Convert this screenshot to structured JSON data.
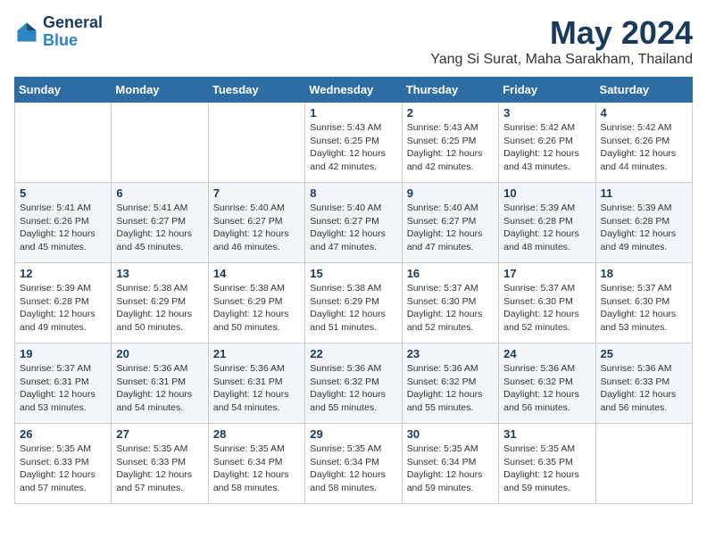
{
  "header": {
    "logo_line1": "General",
    "logo_line2": "Blue",
    "title": "May 2024",
    "subtitle": "Yang Si Surat, Maha Sarakham, Thailand"
  },
  "columns": [
    "Sunday",
    "Monday",
    "Tuesday",
    "Wednesday",
    "Thursday",
    "Friday",
    "Saturday"
  ],
  "weeks": [
    [
      {
        "day": "",
        "info": ""
      },
      {
        "day": "",
        "info": ""
      },
      {
        "day": "",
        "info": ""
      },
      {
        "day": "1",
        "info": "Sunrise: 5:43 AM\nSunset: 6:25 PM\nDaylight: 12 hours\nand 42 minutes."
      },
      {
        "day": "2",
        "info": "Sunrise: 5:43 AM\nSunset: 6:25 PM\nDaylight: 12 hours\nand 42 minutes."
      },
      {
        "day": "3",
        "info": "Sunrise: 5:42 AM\nSunset: 6:26 PM\nDaylight: 12 hours\nand 43 minutes."
      },
      {
        "day": "4",
        "info": "Sunrise: 5:42 AM\nSunset: 6:26 PM\nDaylight: 12 hours\nand 44 minutes."
      }
    ],
    [
      {
        "day": "5",
        "info": "Sunrise: 5:41 AM\nSunset: 6:26 PM\nDaylight: 12 hours\nand 45 minutes."
      },
      {
        "day": "6",
        "info": "Sunrise: 5:41 AM\nSunset: 6:27 PM\nDaylight: 12 hours\nand 45 minutes."
      },
      {
        "day": "7",
        "info": "Sunrise: 5:40 AM\nSunset: 6:27 PM\nDaylight: 12 hours\nand 46 minutes."
      },
      {
        "day": "8",
        "info": "Sunrise: 5:40 AM\nSunset: 6:27 PM\nDaylight: 12 hours\nand 47 minutes."
      },
      {
        "day": "9",
        "info": "Sunrise: 5:40 AM\nSunset: 6:27 PM\nDaylight: 12 hours\nand 47 minutes."
      },
      {
        "day": "10",
        "info": "Sunrise: 5:39 AM\nSunset: 6:28 PM\nDaylight: 12 hours\nand 48 minutes."
      },
      {
        "day": "11",
        "info": "Sunrise: 5:39 AM\nSunset: 6:28 PM\nDaylight: 12 hours\nand 49 minutes."
      }
    ],
    [
      {
        "day": "12",
        "info": "Sunrise: 5:39 AM\nSunset: 6:28 PM\nDaylight: 12 hours\nand 49 minutes."
      },
      {
        "day": "13",
        "info": "Sunrise: 5:38 AM\nSunset: 6:29 PM\nDaylight: 12 hours\nand 50 minutes."
      },
      {
        "day": "14",
        "info": "Sunrise: 5:38 AM\nSunset: 6:29 PM\nDaylight: 12 hours\nand 50 minutes."
      },
      {
        "day": "15",
        "info": "Sunrise: 5:38 AM\nSunset: 6:29 PM\nDaylight: 12 hours\nand 51 minutes."
      },
      {
        "day": "16",
        "info": "Sunrise: 5:37 AM\nSunset: 6:30 PM\nDaylight: 12 hours\nand 52 minutes."
      },
      {
        "day": "17",
        "info": "Sunrise: 5:37 AM\nSunset: 6:30 PM\nDaylight: 12 hours\nand 52 minutes."
      },
      {
        "day": "18",
        "info": "Sunrise: 5:37 AM\nSunset: 6:30 PM\nDaylight: 12 hours\nand 53 minutes."
      }
    ],
    [
      {
        "day": "19",
        "info": "Sunrise: 5:37 AM\nSunset: 6:31 PM\nDaylight: 12 hours\nand 53 minutes."
      },
      {
        "day": "20",
        "info": "Sunrise: 5:36 AM\nSunset: 6:31 PM\nDaylight: 12 hours\nand 54 minutes."
      },
      {
        "day": "21",
        "info": "Sunrise: 5:36 AM\nSunset: 6:31 PM\nDaylight: 12 hours\nand 54 minutes."
      },
      {
        "day": "22",
        "info": "Sunrise: 5:36 AM\nSunset: 6:32 PM\nDaylight: 12 hours\nand 55 minutes."
      },
      {
        "day": "23",
        "info": "Sunrise: 5:36 AM\nSunset: 6:32 PM\nDaylight: 12 hours\nand 55 minutes."
      },
      {
        "day": "24",
        "info": "Sunrise: 5:36 AM\nSunset: 6:32 PM\nDaylight: 12 hours\nand 56 minutes."
      },
      {
        "day": "25",
        "info": "Sunrise: 5:36 AM\nSunset: 6:33 PM\nDaylight: 12 hours\nand 56 minutes."
      }
    ],
    [
      {
        "day": "26",
        "info": "Sunrise: 5:35 AM\nSunset: 6:33 PM\nDaylight: 12 hours\nand 57 minutes."
      },
      {
        "day": "27",
        "info": "Sunrise: 5:35 AM\nSunset: 6:33 PM\nDaylight: 12 hours\nand 57 minutes."
      },
      {
        "day": "28",
        "info": "Sunrise: 5:35 AM\nSunset: 6:34 PM\nDaylight: 12 hours\nand 58 minutes."
      },
      {
        "day": "29",
        "info": "Sunrise: 5:35 AM\nSunset: 6:34 PM\nDaylight: 12 hours\nand 58 minutes."
      },
      {
        "day": "30",
        "info": "Sunrise: 5:35 AM\nSunset: 6:34 PM\nDaylight: 12 hours\nand 59 minutes."
      },
      {
        "day": "31",
        "info": "Sunrise: 5:35 AM\nSunset: 6:35 PM\nDaylight: 12 hours\nand 59 minutes."
      },
      {
        "day": "",
        "info": ""
      }
    ]
  ]
}
